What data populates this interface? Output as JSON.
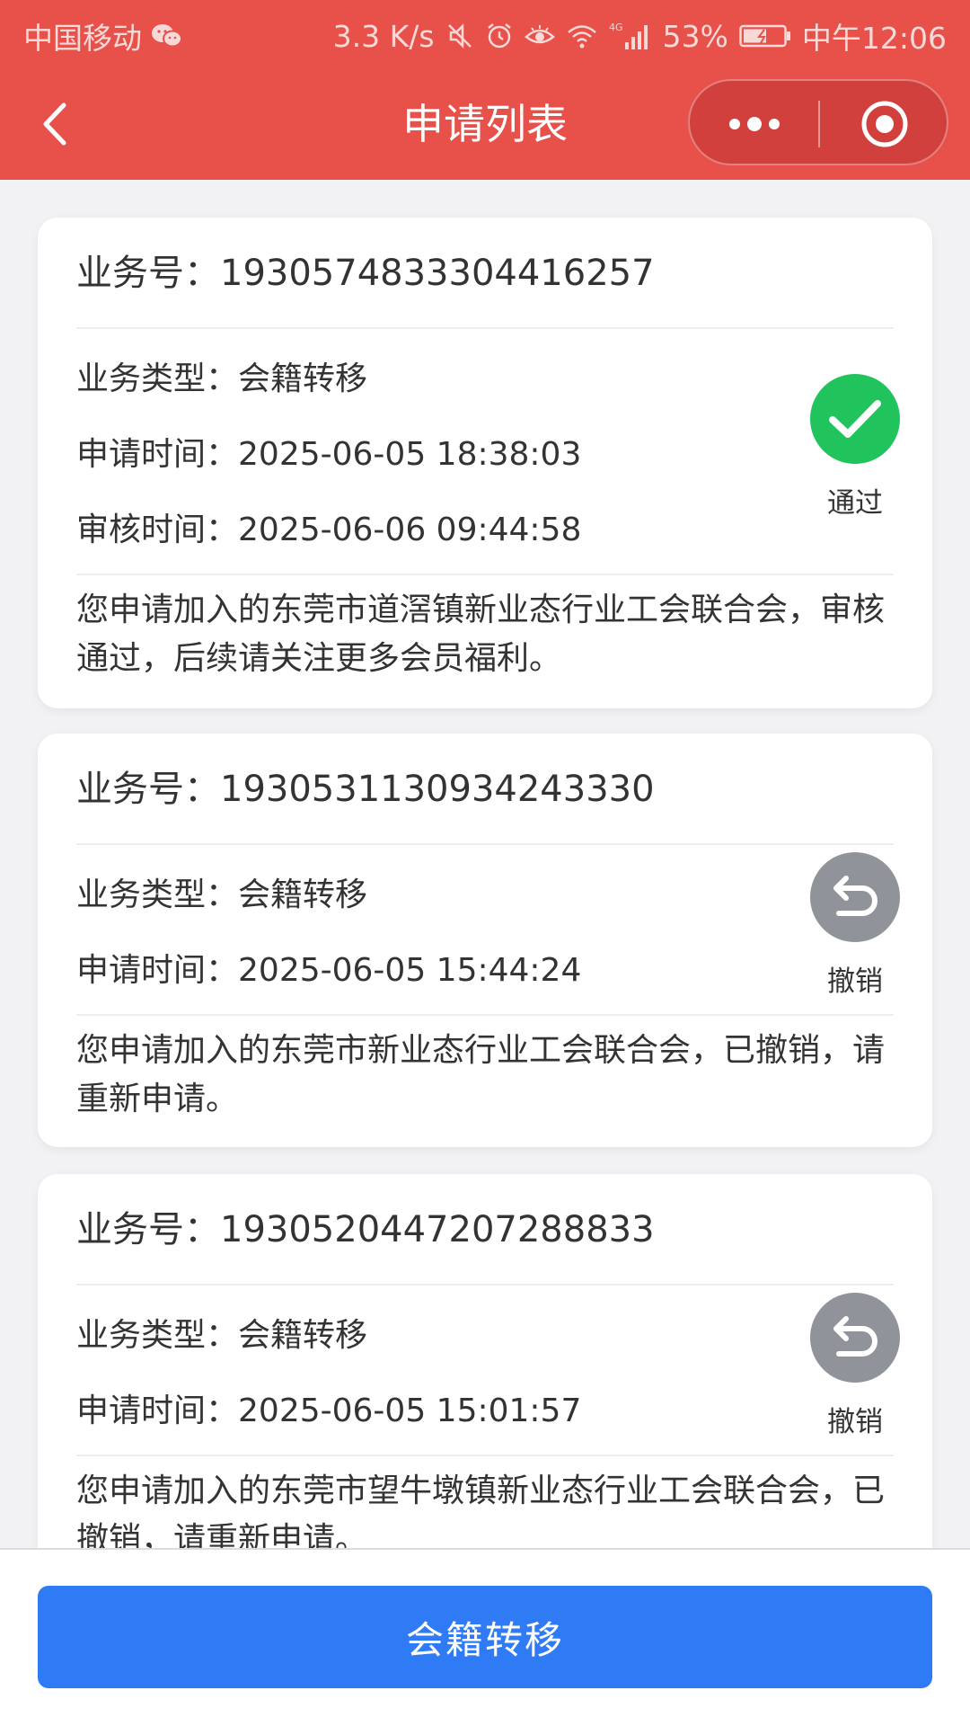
{
  "status_bar": {
    "carrier": "中国移动",
    "net_speed": "3.3 K/s",
    "network_type": "4G",
    "battery": "53%",
    "time": "中午12:06",
    "icons": [
      "wechat-icon",
      "mute-icon",
      "alarm-icon",
      "eye-icon",
      "wifi-icon",
      "signal-icon",
      "battery-icon"
    ]
  },
  "nav": {
    "title": "申请列表",
    "back_icon": "chevron-left-icon",
    "more_icon": "more-dots-icon",
    "close_icon": "target-close-icon"
  },
  "labels": {
    "business_no": "业务号：",
    "business_type": "业务类型：",
    "apply_time": "申请时间：",
    "review_time": "审核时间："
  },
  "applications": [
    {
      "business_no": "1930574833304416257",
      "business_type": "会籍转移",
      "apply_time": "2025-06-05 18:38:03",
      "review_time": "2025-06-06 09:44:58",
      "status": "通过",
      "status_icon": "check-icon",
      "status_color": "#21c45c",
      "message": "您申请加入的东莞市道滘镇新业态行业工会联合会，审核通过，后续请关注更多会员福利。"
    },
    {
      "business_no": "1930531130934243330",
      "business_type": "会籍转移",
      "apply_time": "2025-06-05 15:44:24",
      "status": "撤销",
      "status_icon": "undo-icon",
      "status_color": "#909399",
      "message": "您申请加入的东莞市新业态行业工会联合会，已撤销，请重新申请。"
    },
    {
      "business_no": "1930520447207288833",
      "business_type": "会籍转移",
      "apply_time": "2025-06-05 15:01:57",
      "status": "撤销",
      "status_icon": "undo-icon",
      "status_color": "#909399",
      "message": "您申请加入的东莞市望牛墩镇新业态行业工会联合会，已撤销，请重新申请。"
    }
  ],
  "bottom": {
    "button_label": "会籍转移",
    "button_color": "#2f7af5"
  },
  "theme": {
    "header_color": "#e8504a",
    "background": "#f2f2f4"
  }
}
